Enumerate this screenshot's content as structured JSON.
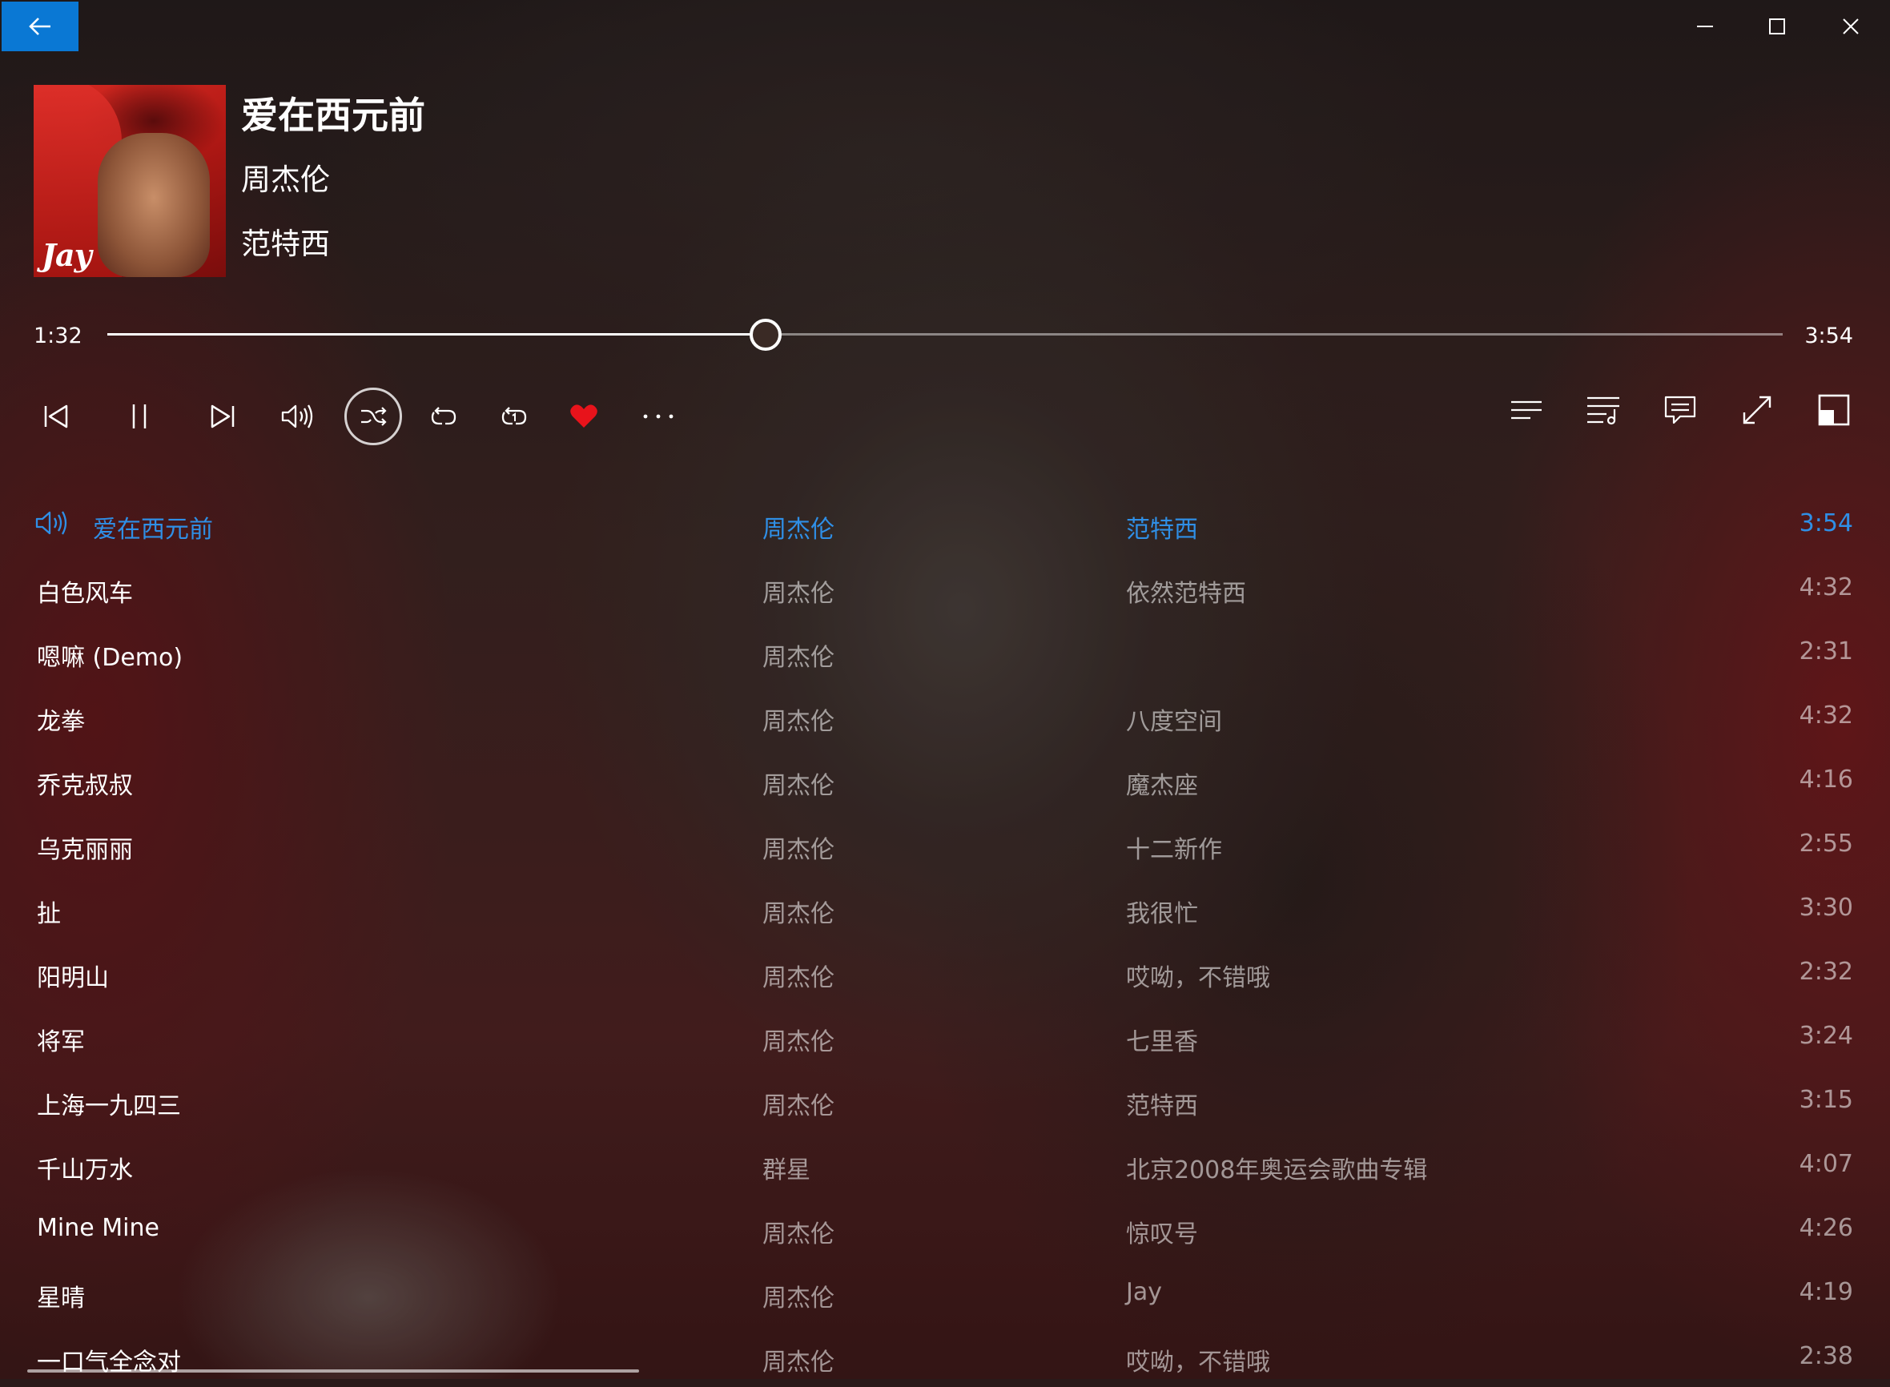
{
  "window": {
    "back_icon": "arrow-left-icon",
    "minimize_icon": "minimize-icon",
    "maximize_icon": "maximize-icon",
    "close_icon": "close-icon",
    "accent": "#0a78d4"
  },
  "now_playing": {
    "title": "爱在西元前",
    "artist": "周杰伦",
    "album": "范特西",
    "cover_text": "Jay"
  },
  "progress": {
    "current": "1:32",
    "total": "3:54",
    "fraction": 0.393
  },
  "controls": {
    "items": [
      "previous-icon",
      "pause-icon",
      "next-icon",
      "volume-icon",
      "shuffle-icon",
      "repeat-icon",
      "repeat-one-icon",
      "heart-icon",
      "more-icon"
    ],
    "right_items": [
      "lyrics-icon",
      "playlist-icon",
      "comment-icon",
      "fullscreen-icon",
      "mini-mode-icon"
    ],
    "heart_color": "#e8131b"
  },
  "playlist": {
    "active_color": "#2f8fe6",
    "rows": [
      {
        "title": "爱在西元前",
        "artist": "周杰伦",
        "album": "范特西",
        "duration": "3:54",
        "active": true
      },
      {
        "title": "白色风车",
        "artist": "周杰伦",
        "album": "依然范特西",
        "duration": "4:32"
      },
      {
        "title": "嗯嘛 (Demo)",
        "artist": "周杰伦",
        "album": "",
        "duration": "2:31"
      },
      {
        "title": "龙拳",
        "artist": "周杰伦",
        "album": "八度空间",
        "duration": "4:32"
      },
      {
        "title": "乔克叔叔",
        "artist": "周杰伦",
        "album": "魔杰座",
        "duration": "4:16"
      },
      {
        "title": "乌克丽丽",
        "artist": "周杰伦",
        "album": "十二新作",
        "duration": "2:55"
      },
      {
        "title": "扯",
        "artist": "周杰伦",
        "album": "我很忙",
        "duration": "3:30"
      },
      {
        "title": "阳明山",
        "artist": "周杰伦",
        "album": "哎呦，不错哦",
        "duration": "2:32"
      },
      {
        "title": "将军",
        "artist": "周杰伦",
        "album": "七里香",
        "duration": "3:24"
      },
      {
        "title": "上海一九四三",
        "artist": "周杰伦",
        "album": "范特西",
        "duration": "3:15"
      },
      {
        "title": "千山万水",
        "artist": "群星",
        "album": "北京2008年奥运会歌曲专辑",
        "duration": "4:07"
      },
      {
        "title": "Mine Mine",
        "artist": "周杰伦",
        "album": "惊叹号",
        "duration": "4:26"
      },
      {
        "title": "星晴",
        "artist": "周杰伦",
        "album": "Jay",
        "duration": "4:19"
      },
      {
        "title": "一口气全念对",
        "artist": "周杰伦",
        "album": "哎呦，不错哦",
        "duration": "2:38"
      }
    ]
  }
}
